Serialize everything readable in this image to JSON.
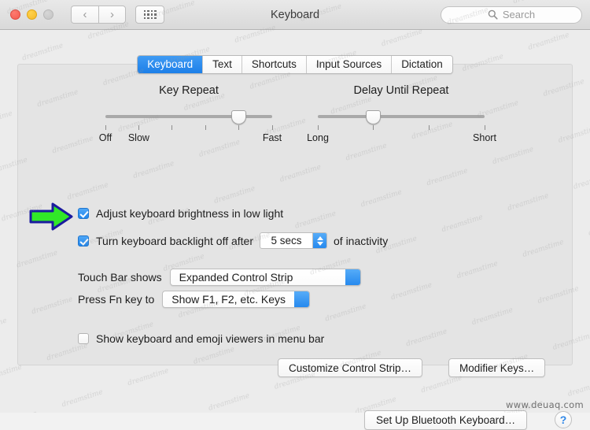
{
  "window": {
    "title": "Keyboard",
    "traffic_lights": [
      {
        "name": "close",
        "color": "#f15b50"
      },
      {
        "name": "minimize",
        "color": "#f5b928"
      },
      {
        "name": "zoom",
        "color": "#c4c4c4"
      }
    ],
    "nav": {
      "back": "‹",
      "forward": "›",
      "show_all": "grid-icon"
    },
    "search": {
      "placeholder": "Search",
      "value": ""
    }
  },
  "tabs": [
    {
      "label": "Keyboard",
      "active": true
    },
    {
      "label": "Text",
      "active": false
    },
    {
      "label": "Shortcuts",
      "active": false
    },
    {
      "label": "Input Sources",
      "active": false
    },
    {
      "label": "Dictation",
      "active": false
    }
  ],
  "sliders": {
    "key_repeat": {
      "title": "Key Repeat",
      "ticks": 6,
      "value_index": 4,
      "labels": [
        {
          "text": "Off",
          "pos_pct": 0
        },
        {
          "text": "Slow",
          "pos_pct": 20
        },
        {
          "text": "Fast",
          "pos_pct": 100
        }
      ]
    },
    "delay_until_repeat": {
      "title": "Delay Until Repeat",
      "ticks": 4,
      "value_index": 1,
      "labels": [
        {
          "text": "Long",
          "pos_pct": 0
        },
        {
          "text": "Short",
          "pos_pct": 100
        }
      ]
    }
  },
  "options": {
    "adjust_brightness": {
      "label": "Adjust keyboard brightness in low light",
      "checked": true
    },
    "backlight_off": {
      "label_before": "Turn keyboard backlight off after",
      "label_after": "of inactivity",
      "checked": true,
      "duration_value": "5 secs"
    },
    "show_viewers": {
      "label": "Show keyboard and emoji viewers in menu bar",
      "checked": false
    }
  },
  "popups": {
    "touch_bar": {
      "label": "Touch Bar shows",
      "value": "Expanded Control Strip"
    },
    "fn_key": {
      "label": "Press Fn key to",
      "value": "Show F1, F2, etc. Keys"
    }
  },
  "buttons": {
    "customize_control_strip": "Customize Control Strip…",
    "modifier_keys": "Modifier Keys…",
    "set_up_bluetooth": "Set Up Bluetooth Keyboard…",
    "help": "?"
  },
  "annotation": {
    "arrow": {
      "name": "green-arrow-annotation",
      "fill": "#31e828",
      "stroke": "#1b1b9e",
      "points_to": "adjust-keyboard-brightness-checkbox"
    }
  },
  "watermark": {
    "text": "www.deuaq.com"
  }
}
